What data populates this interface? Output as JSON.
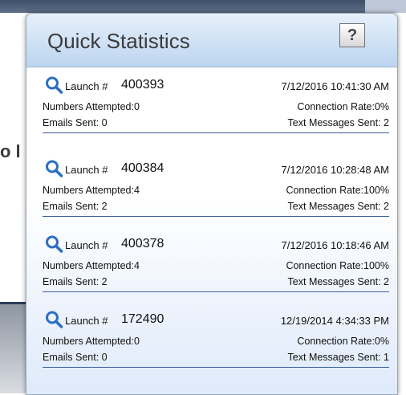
{
  "panel": {
    "title": "Quick Statistics",
    "help_label": "?"
  },
  "background": {
    "fragment_text": "o l"
  },
  "labels": {
    "launch_prefix": "Launch #",
    "numbers_attempted": "Numbers Attempted:",
    "connection_rate": "Connection Rate:",
    "emails_sent": "Emails Sent: ",
    "text_messages_sent": "Text Messages Sent: "
  },
  "launches": [
    {
      "launch_label": "Launch #",
      "launch_number": "400393",
      "timestamp": "7/12/2016 10:41:30 AM",
      "numbers_attempted": "Numbers Attempted:0",
      "connection_rate": "Connection Rate:0%",
      "emails_sent": "Emails Sent: 0",
      "text_messages_sent": "Text Messages Sent: 2"
    },
    {
      "launch_label": "Launch #",
      "launch_number": "400384",
      "timestamp": "7/12/2016 10:28:48 AM",
      "numbers_attempted": "Numbers Attempted:4",
      "connection_rate": "Connection Rate:100%",
      "emails_sent": "Emails Sent: 2",
      "text_messages_sent": "Text Messages Sent: 2"
    },
    {
      "launch_label": "Launch #",
      "launch_number": "400378",
      "timestamp": "7/12/2016 10:18:46 AM",
      "numbers_attempted": "Numbers Attempted:4",
      "connection_rate": "Connection Rate:100%",
      "emails_sent": "Emails Sent: 2",
      "text_messages_sent": "Text Messages Sent: 2"
    },
    {
      "launch_label": "Launch #",
      "launch_number": "172490",
      "timestamp": "12/19/2014 4:34:33 PM",
      "numbers_attempted": "Numbers Attempted:0",
      "connection_rate": "Connection Rate:0%",
      "emails_sent": "Emails Sent: 0",
      "text_messages_sent": "Text Messages Sent: 1"
    }
  ],
  "icons": {
    "launch_details": "magnifier-icon",
    "help": "question-mark-icon"
  },
  "colors": {
    "header_gradient_top": "#e6f0fb",
    "header_gradient_bottom": "#bcd5ef",
    "divider": "#3a5c99",
    "magnifier": "#2d6fc4"
  }
}
